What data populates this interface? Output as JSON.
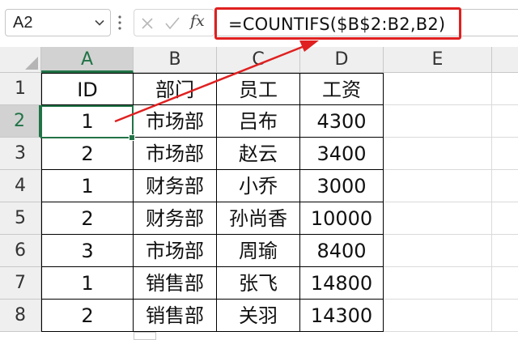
{
  "name_box": {
    "value": "A2"
  },
  "formula_bar": {
    "fx_label": "fx",
    "formula": "=COUNTIFS($B$2:B2,B2)"
  },
  "columns": [
    "A",
    "B",
    "C",
    "D",
    "E"
  ],
  "rows": [
    "1",
    "2",
    "3",
    "4",
    "5",
    "6",
    "7",
    "8"
  ],
  "table": {
    "header": [
      "ID",
      "部门",
      "员工",
      "工资"
    ],
    "data": [
      [
        "1",
        "市场部",
        "吕布",
        "4300"
      ],
      [
        "2",
        "市场部",
        "赵云",
        "3400"
      ],
      [
        "1",
        "财务部",
        "小乔",
        "3000"
      ],
      [
        "2",
        "财务部",
        "孙尚香",
        "10000"
      ],
      [
        "3",
        "市场部",
        "周瑜",
        "8400"
      ],
      [
        "1",
        "销售部",
        "张飞",
        "14800"
      ],
      [
        "2",
        "销售部",
        "关羽",
        "14300"
      ]
    ]
  },
  "colors": {
    "accent_green": "#217346",
    "highlight_red": "#e02020"
  }
}
